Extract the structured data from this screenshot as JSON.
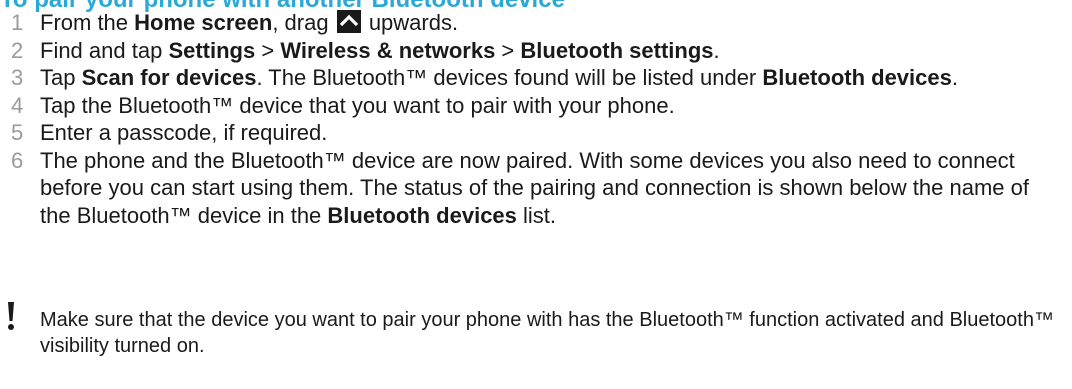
{
  "header": {
    "partial_title": "To pair your phone with another Bluetooth device"
  },
  "steps": [
    {
      "num": "1",
      "parts": [
        {
          "t": "From the ",
          "b": false
        },
        {
          "t": "Home screen",
          "b": true
        },
        {
          "t": ", drag ",
          "b": false
        },
        {
          "icon": "arrow-up-icon"
        },
        {
          "t": " upwards.",
          "b": false
        }
      ]
    },
    {
      "num": "2",
      "parts": [
        {
          "t": "Find and tap ",
          "b": false
        },
        {
          "t": "Settings",
          "b": true
        },
        {
          "t": " > ",
          "b": false
        },
        {
          "t": "Wireless & networks",
          "b": true
        },
        {
          "t": " > ",
          "b": false
        },
        {
          "t": "Bluetooth settings",
          "b": true
        },
        {
          "t": ".",
          "b": false
        }
      ]
    },
    {
      "num": "3",
      "parts": [
        {
          "t": "Tap ",
          "b": false
        },
        {
          "t": "Scan for devices",
          "b": true
        },
        {
          "t": ". The Bluetooth™ devices found will be listed under ",
          "b": false
        },
        {
          "t": "Bluetooth devices",
          "b": true
        },
        {
          "t": ".",
          "b": false
        }
      ]
    },
    {
      "num": "4",
      "parts": [
        {
          "t": "Tap the Bluetooth™ device that you want to pair with your phone.",
          "b": false
        }
      ]
    },
    {
      "num": "5",
      "parts": [
        {
          "t": "Enter a passcode, if required.",
          "b": false
        }
      ]
    },
    {
      "num": "6",
      "parts": [
        {
          "t": "The phone and the Bluetooth™ device are now paired. With some devices you also need to connect before you can start using them. The status of the pairing and connection is shown below the name of the Bluetooth™ device in the ",
          "b": false
        },
        {
          "t": "Bluetooth devices",
          "b": true
        },
        {
          "t": " list.",
          "b": false
        }
      ]
    }
  ],
  "note": {
    "icon": "exclamation-icon",
    "text": "Make sure that the device you want to pair your phone with has the Bluetooth™ function activated and Bluetooth™ visibility turned on."
  },
  "colors": {
    "heading": "#2aa8d6",
    "step_number": "#9a9a9a",
    "text": "#1a1a1a"
  }
}
